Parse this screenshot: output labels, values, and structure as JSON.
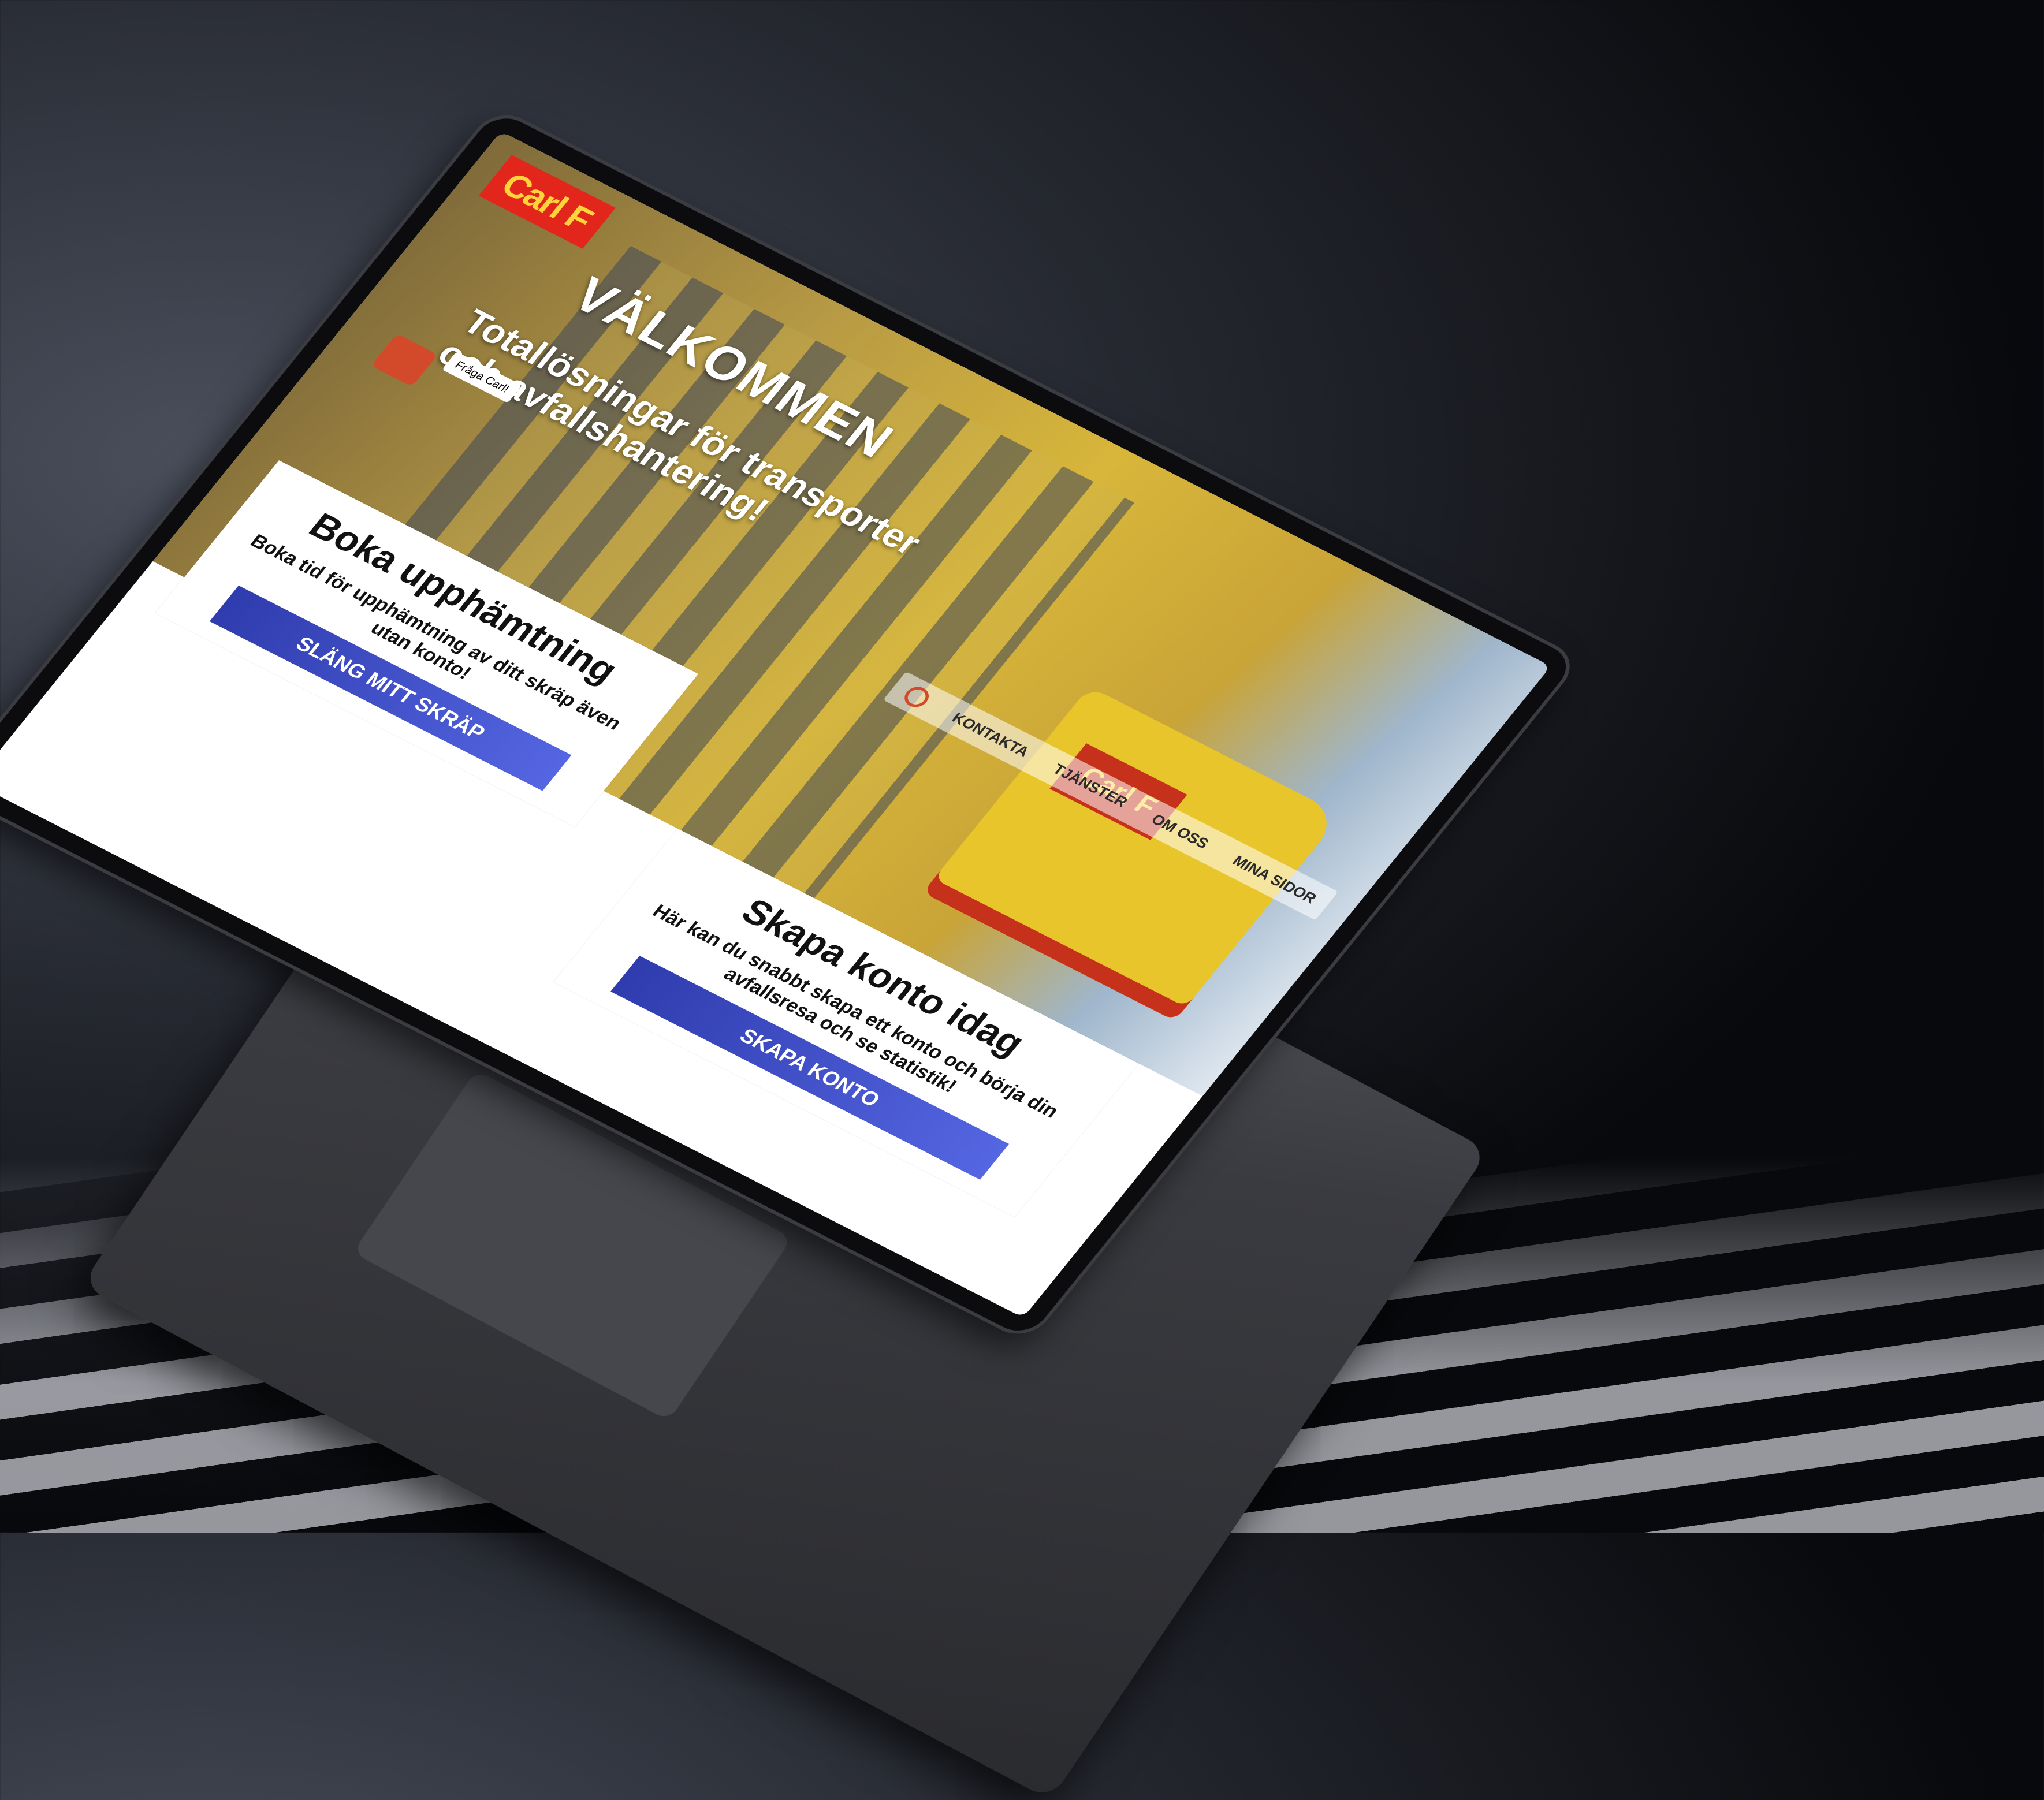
{
  "logo": "Carl F",
  "hero": {
    "title": "VÄLKOMMEN",
    "subtitle": "Totallösningar för transporter och avfallshantering!",
    "chat_label": "Fråga Carl!"
  },
  "nav": {
    "items": [
      "KONTAKTA",
      "TJÄNSTER",
      "OM OSS",
      "MINA SIDOR"
    ]
  },
  "cards": [
    {
      "title": "Boka upphämtning",
      "text": "Boka tid för upphämtning av ditt skräp även utan konto!",
      "button": "SLÄNG MITT SKRÄP"
    },
    {
      "title": "Skapa konto idag",
      "text": "Här kan du snabbt skapa ett konto och börja din avfallsresa och se statistik!",
      "button": "SKAPA KONTO"
    }
  ],
  "colors": {
    "accent_red": "#e2261b",
    "accent_yellow": "#ffd43a",
    "button_blue": "#2f3cae"
  }
}
